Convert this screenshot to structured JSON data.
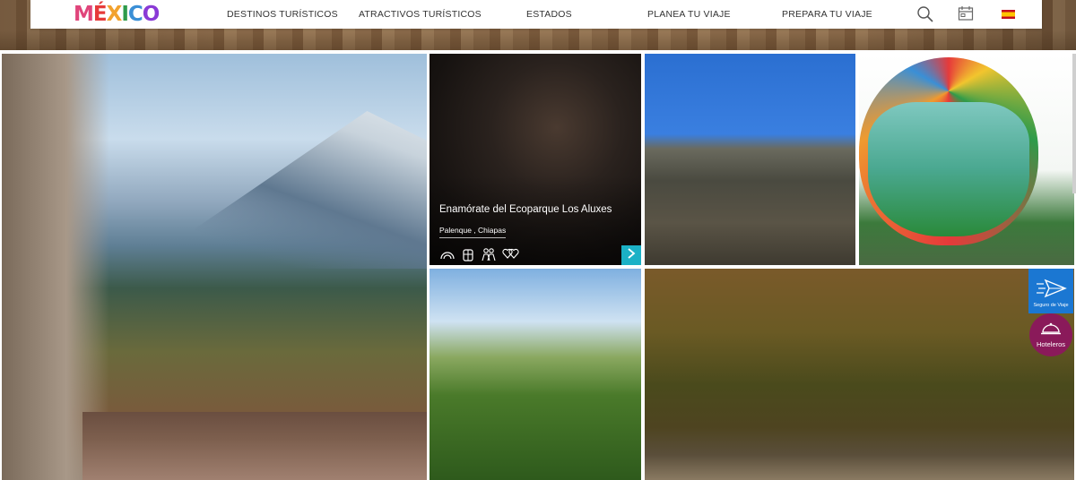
{
  "logo": {
    "text": [
      "M",
      "É",
      "X",
      "I",
      "C",
      "O"
    ],
    "colors": [
      "#e0457b",
      "#e63a3a",
      "#f2a22e",
      "#2e9b4a",
      "#3a8fd6",
      "#8a3ad6"
    ]
  },
  "nav": {
    "items": [
      {
        "label": "DESTINOS TURÍSTICOS"
      },
      {
        "label": "ATRACTIVOS TURÍSTICOS"
      },
      {
        "label": "ESTADOS"
      },
      {
        "label": "PLANEA TU VIAJE"
      },
      {
        "label": "PREPARA TU VIAJE"
      }
    ],
    "icons": [
      "search-icon",
      "calendar-icon",
      "spain-flag-icon"
    ]
  },
  "tiles": {
    "featured": {
      "title": "Enamórate del Ecoparque Los Aluxes",
      "location": "Palenque , Chiapas",
      "icons": [
        "rainbow-icon",
        "backpack-icon",
        "family-icon",
        "hearts-icon"
      ]
    }
  },
  "floating": {
    "seguro": "Seguro de Viaje",
    "hoteleros": "Hoteleros"
  },
  "colors": {
    "accent_teal": "#1bb1c6",
    "seguro_blue": "#1b77d2",
    "hoteleros_purple": "#8a1a5a"
  }
}
